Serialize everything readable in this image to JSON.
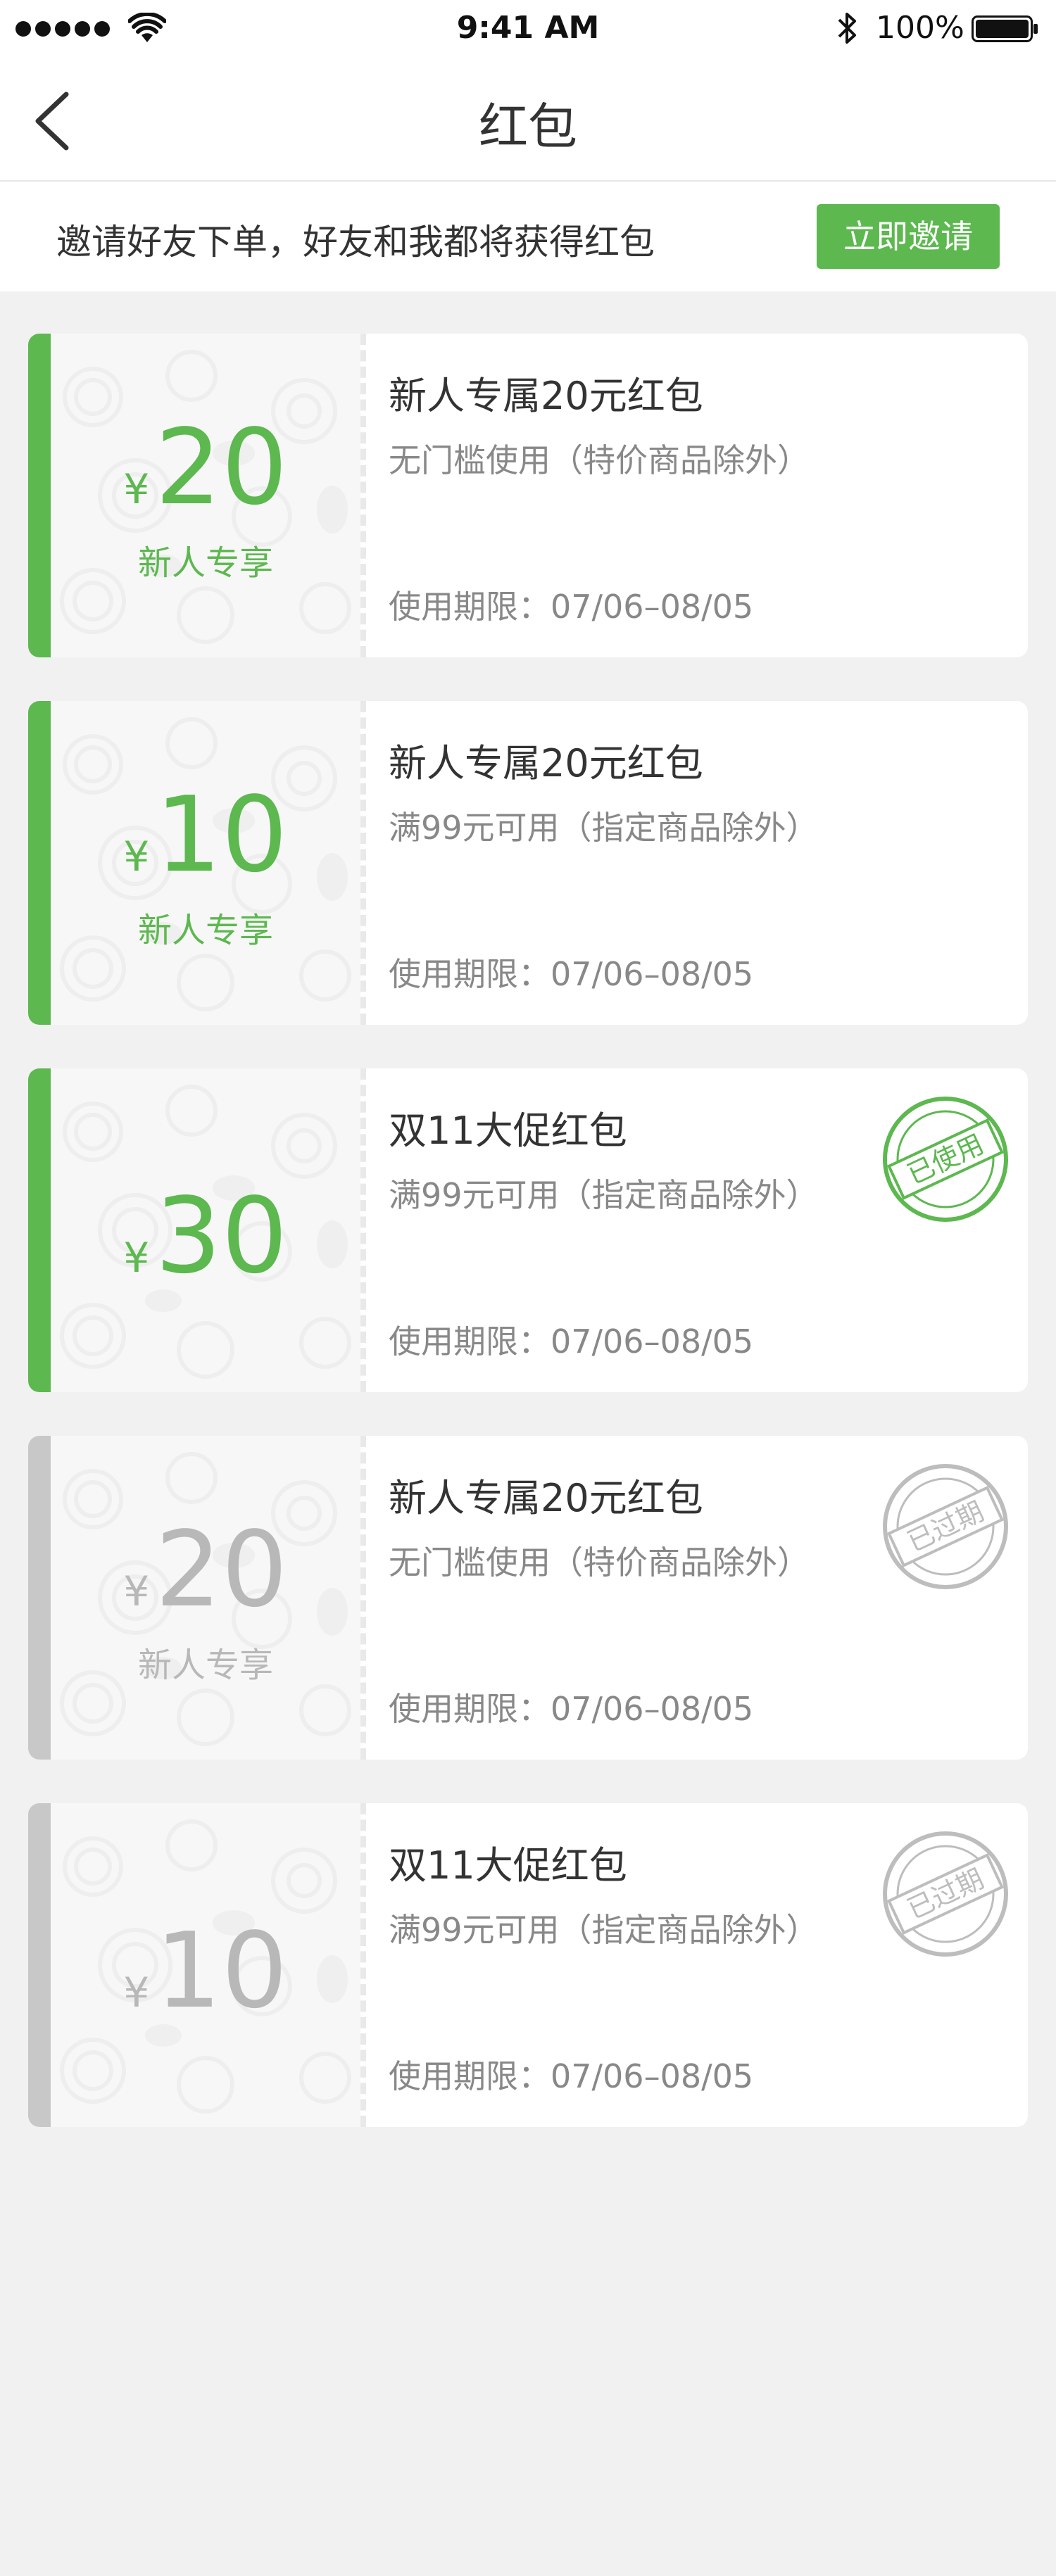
{
  "status_bar": {
    "time": "9:41 AM",
    "battery_percent": "100%",
    "icons": [
      "signal-dots-icon",
      "wifi-icon",
      "bluetooth-icon",
      "battery-icon"
    ]
  },
  "nav": {
    "title": "红包",
    "back_icon": "chevron-left-icon"
  },
  "invite": {
    "text": "邀请好友下单，好友和我都将获得红包",
    "button": "立即邀请"
  },
  "colors": {
    "accent_green": "#5cb84f",
    "inactive_gray": "#b8b8b8"
  },
  "coupons": [
    {
      "currency": "¥",
      "amount": "20",
      "tag": "新人专享",
      "title": "新人专属20元红包",
      "condition": "无门槛使用（特价商品除外）",
      "validity": "使用期限：07/06–08/05",
      "state": "active",
      "stamp": ""
    },
    {
      "currency": "¥",
      "amount": "10",
      "tag": "新人专享",
      "title": "新人专属20元红包",
      "condition": "满99元可用（指定商品除外）",
      "validity": "使用期限：07/06–08/05",
      "state": "active",
      "stamp": ""
    },
    {
      "currency": "¥",
      "amount": "30",
      "tag": "",
      "title": "双11大促红包",
      "condition": "满99元可用（指定商品除外）",
      "validity": "使用期限：07/06–08/05",
      "state": "used",
      "stamp": "已使用"
    },
    {
      "currency": "¥",
      "amount": "20",
      "tag": "新人专享",
      "title": "新人专属20元红包",
      "condition": "无门槛使用（特价商品除外）",
      "validity": "使用期限：07/06–08/05",
      "state": "expired",
      "stamp": "已过期"
    },
    {
      "currency": "¥",
      "amount": "10",
      "tag": "",
      "title": "双11大促红包",
      "condition": "满99元可用（指定商品除外）",
      "validity": "使用期限：07/06–08/05",
      "state": "expired",
      "stamp": "已过期"
    }
  ]
}
